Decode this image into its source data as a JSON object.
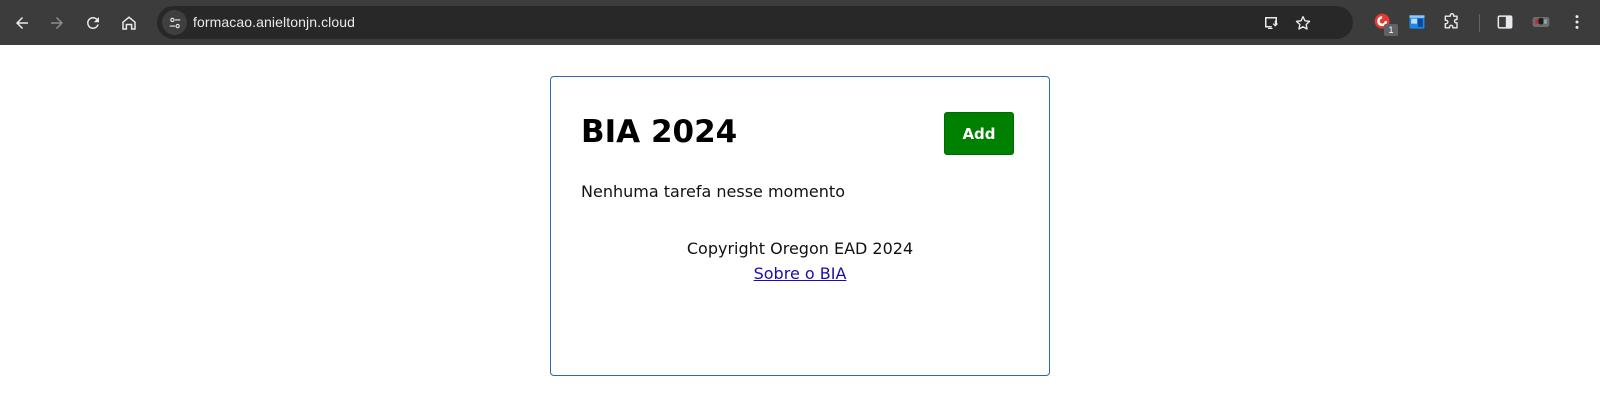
{
  "browser": {
    "url": "formacao.anieltonjn.cloud",
    "extension_badge": "1"
  },
  "page": {
    "title": "BIA 2024",
    "add_button_label": "Add",
    "empty_message": "Nenhuma tarefa nesse momento",
    "footer": {
      "copyright": "Copyright Oregon EAD 2024",
      "about_link": "Sobre o BIA"
    }
  },
  "colors": {
    "browser_frame": "#3c3c3c",
    "omnibox": "#282828",
    "card_border": "#2d6aa3",
    "add_button": "#008000",
    "link": "#1a0dab"
  },
  "icons": {
    "back": "arrow-left-icon",
    "forward": "arrow-right-icon",
    "reload": "reload-icon",
    "home": "home-icon",
    "site_info": "tune-icon",
    "install": "install-app-icon",
    "bookmark": "star-icon",
    "extensions": "puzzle-icon",
    "side_panel": "side-panel-icon",
    "profile": "avatar",
    "menu": "kebab-menu-icon"
  }
}
